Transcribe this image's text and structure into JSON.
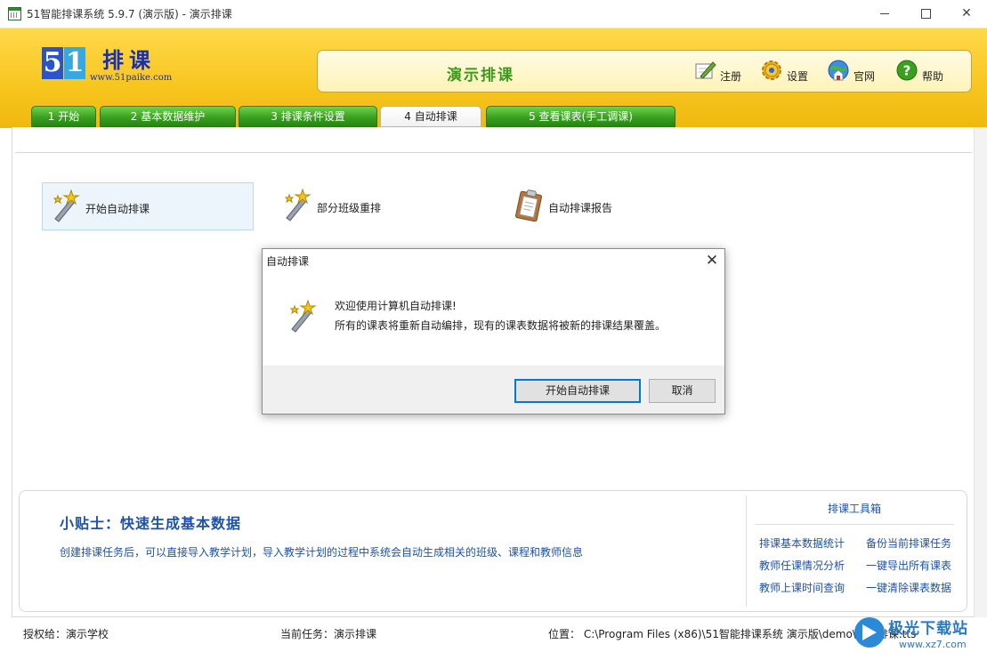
{
  "window": {
    "title": "51智能排课系统 5.9.7 (演示版) - 演示排课",
    "close_glyph": "✕"
  },
  "header": {
    "logo_digit1": "5",
    "logo_digit2": "1",
    "logo_text": "排课",
    "logo_url": "www.51paike.com",
    "banner_title": "演示排课",
    "tools": {
      "register": "注册",
      "settings": "设置",
      "website": "官网",
      "help": "帮助"
    }
  },
  "tabs": [
    {
      "label": "1 开始"
    },
    {
      "label": "2 基本数据维护"
    },
    {
      "label": "3 排课条件设置"
    },
    {
      "label": "4 自动排课",
      "active": true
    },
    {
      "label": "5 查看课表(手工调课)"
    }
  ],
  "actions": {
    "start_auto": "开始自动排课",
    "partial_rearrange": "部分班级重排",
    "report": "自动排课报告"
  },
  "tips": {
    "title": "小贴士：快速生成基本数据",
    "text": "创建排课任务后，可以直接导入教学计划，导入教学计划的过程中系统会自动生成相关的班级、课程和教师信息"
  },
  "toolbox": {
    "title": "排课工具箱",
    "links": [
      "排课基本数据统计",
      "备份当前排课任务",
      "教师任课情况分析",
      "一键导出所有课表",
      "教师上课时间查询",
      "一键清除课表数据"
    ]
  },
  "status": {
    "licensed_to": "授权给：演示学校",
    "current_task": "当前任务：演示排课",
    "location": "位置：  C:\\Program Files (x86)\\51智能排课系统 演示版\\demo\\演示排课.tts"
  },
  "watermark": {
    "text": "极光下载站",
    "url": "www.xz7.com"
  },
  "dialog": {
    "title": "自动排课",
    "message_line1": "欢迎使用计算机自动排课!",
    "message_line2": "所有的课表将重新自动编排，现有的课表数据将被新的排课结果覆盖。",
    "ok_label": "开始自动排课",
    "cancel_label": "取消"
  },
  "colors": {
    "header_yellow": "#f7c51e",
    "tab_green": "#3aa01f",
    "link_blue": "#1d52a8",
    "banner_green_text": "#3a9a1a",
    "focus_blue": "#0078d7"
  }
}
